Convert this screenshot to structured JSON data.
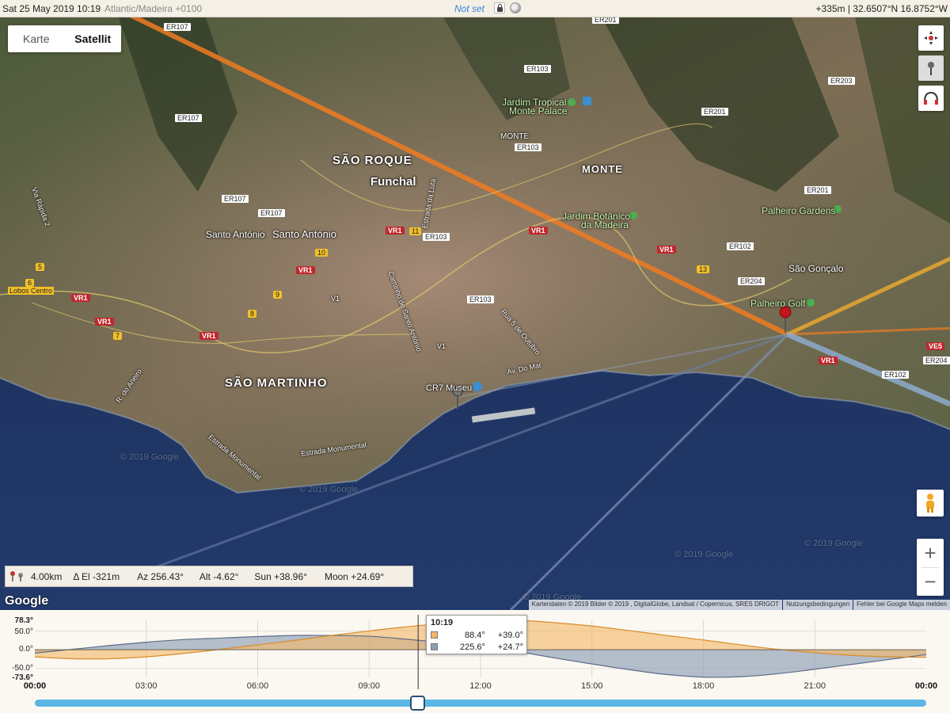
{
  "topbar": {
    "date": "Sat 25 May 2019 10:19",
    "timezone": "Atlantic/Madeira +0100",
    "status": "Not set",
    "lock_icon": "lock-icon",
    "moon_icon": "moon-phase-icon",
    "elevation_coords": "+335m | 32.6507°N 16.8752°W"
  },
  "map": {
    "type_buttons": [
      {
        "label": "Karte",
        "active": false
      },
      {
        "label": "Satellit",
        "active": true
      }
    ],
    "labels": {
      "sao_roque": "SÃO ROQUE",
      "funchal": "Funchal",
      "monte_upper": "MONTE",
      "monte_small": "MONTE",
      "jardim_tropical": "Jardim Tropical",
      "monte_palace": "Monte Palace",
      "jardim_botanico": "Jardim Botânico",
      "da_madeira": "da Madeira",
      "palheiro_gardens": "Palheiro Gardens",
      "sao_goncalo": "São Gonçalo",
      "palheiro_golf": "Palheiro Golf",
      "santo_antonio_1": "Santo António",
      "santo_antonio_2": "Santo António",
      "sao_martinho": "SÃO MARTINHO",
      "cr7_museu": "CR7 Museu",
      "lobos_centro": "Lobos Centro",
      "via_rapida": "Via Rápida 2",
      "r_do_arieiro": "R. do Arieiro",
      "estrada_monumental_1": "Estrada Monumental",
      "estrada_monumental_2": "Estrada Monumental",
      "rua_5_outubro": "Rua 5 de Outubro",
      "caminho_santo_antonio": "Caminho de Santo António",
      "estrada_luta": "Estrada da Luta",
      "av_do_mar": "Av. Do Mar",
      "v1_a": "V1",
      "v1_b": "V1"
    },
    "roads": {
      "er107_a": "ER107",
      "er107_b": "ER107",
      "er107_c": "ER107",
      "er107_d": "ER107",
      "er103_a": "ER103",
      "er103_b": "ER103",
      "er103_c": "ER103",
      "er103_d": "ER103",
      "er201_a": "ER201",
      "er201_b": "ER201",
      "er201_c": "ER201",
      "er203": "ER203",
      "er102_a": "ER102",
      "er102_b": "ER102",
      "er204_a": "ER204",
      "er204_b": "ER204",
      "vr1_a": "VR1",
      "vr1_b": "VR1",
      "vr1_c": "VR1",
      "vr1_d": "VR1",
      "vr1_e": "VR1",
      "vr1_f": "VR1",
      "vr1_g": "VR1",
      "vr1_h": "VR1",
      "vr1_i": "VR1",
      "vr1_j": "VR1",
      "ve5": "VE5",
      "n11": "11",
      "n10": "10",
      "n13": "13",
      "n9": "9",
      "n8": "8",
      "n7": "7",
      "n6": "6",
      "n5": "5"
    },
    "watermarks": [
      "© 2019 Google",
      "© 2019 Google",
      "© 2019 Google",
      "© 2019 Google",
      "© 2019 Google"
    ],
    "google_logo": "Google",
    "attribution": [
      "Kartendaten © 2019 Bilder © 2019 , DigitalGlobe, Landsat / Copernicus, SRES DRIGOT",
      "Nutzungsbedingungen",
      "Fehler bei Google Maps melden"
    ],
    "controls": {
      "locate_icon": "crosshair-icon",
      "pin_icon": "map-pin-icon",
      "headphones_icon": "headphones-icon",
      "pegman_icon": "pegman-icon",
      "zoom_in": "+",
      "zoom_out": "−"
    },
    "colors": {
      "sun_line": "#f07c22",
      "sunset_line": "#e8a830",
      "moon_line": "#8fb0d6",
      "pin": "#c3151c"
    }
  },
  "infobar": {
    "icon": "distance-pins-icon",
    "distance": "4.00km",
    "delta_el": "Δ El  -321m",
    "azimuth": "Az 256.43°",
    "altitude": "Alt  -4.62°",
    "sun": "Sun +38.96°",
    "moon": "Moon +24.69°"
  },
  "timeline": {
    "y_labels": {
      "max": "78.3°",
      "p50": "50.0°",
      "zero": "0.0°",
      "m50": "-50.0°",
      "min": "-73.6°"
    },
    "x_labels": [
      "00:00",
      "03:00",
      "06:00",
      "09:00",
      "12:00",
      "15:00",
      "18:00",
      "21:00",
      "00:00"
    ],
    "tooltip": {
      "time": "10:19",
      "sun_azimuth": "88.4°",
      "sun_altitude": "+39.0°",
      "moon_azimuth": "225.6°",
      "moon_altitude": "+24.7°"
    },
    "colors": {
      "sun": "#f3b765",
      "moon": "#8e9db3"
    }
  },
  "chart_data": {
    "type": "area",
    "x_unit": "hour",
    "xlim": [
      0,
      24
    ],
    "ylim": [
      -73.6,
      78.3
    ],
    "current_time": 10.32,
    "series": [
      {
        "name": "Sun",
        "x": [
          0,
          1,
          2,
          3,
          4,
          5,
          6,
          7,
          8,
          9,
          10,
          11,
          12,
          13,
          14,
          15,
          16,
          17,
          18,
          19,
          20,
          21,
          22,
          23,
          24
        ],
        "values": [
          -19,
          -24,
          -24,
          -19,
          -10,
          1,
          13,
          25,
          38,
          50,
          61,
          70,
          76,
          78,
          72,
          63,
          51,
          38,
          26,
          13,
          1,
          -8,
          -15,
          -19,
          -20
        ]
      },
      {
        "name": "Moon",
        "x": [
          0,
          1,
          2,
          3,
          4,
          5,
          6,
          7,
          8,
          9,
          10,
          11,
          12,
          13,
          14,
          15,
          16,
          17,
          18,
          19,
          20,
          21,
          22,
          23,
          24
        ],
        "values": [
          -9,
          1,
          11,
          20,
          27,
          31,
          35,
          38,
          38,
          36,
          28,
          19,
          9,
          -5,
          -22,
          -38,
          -53,
          -66,
          -73,
          -72,
          -64,
          -52,
          -39,
          -26,
          -13
        ]
      }
    ]
  }
}
